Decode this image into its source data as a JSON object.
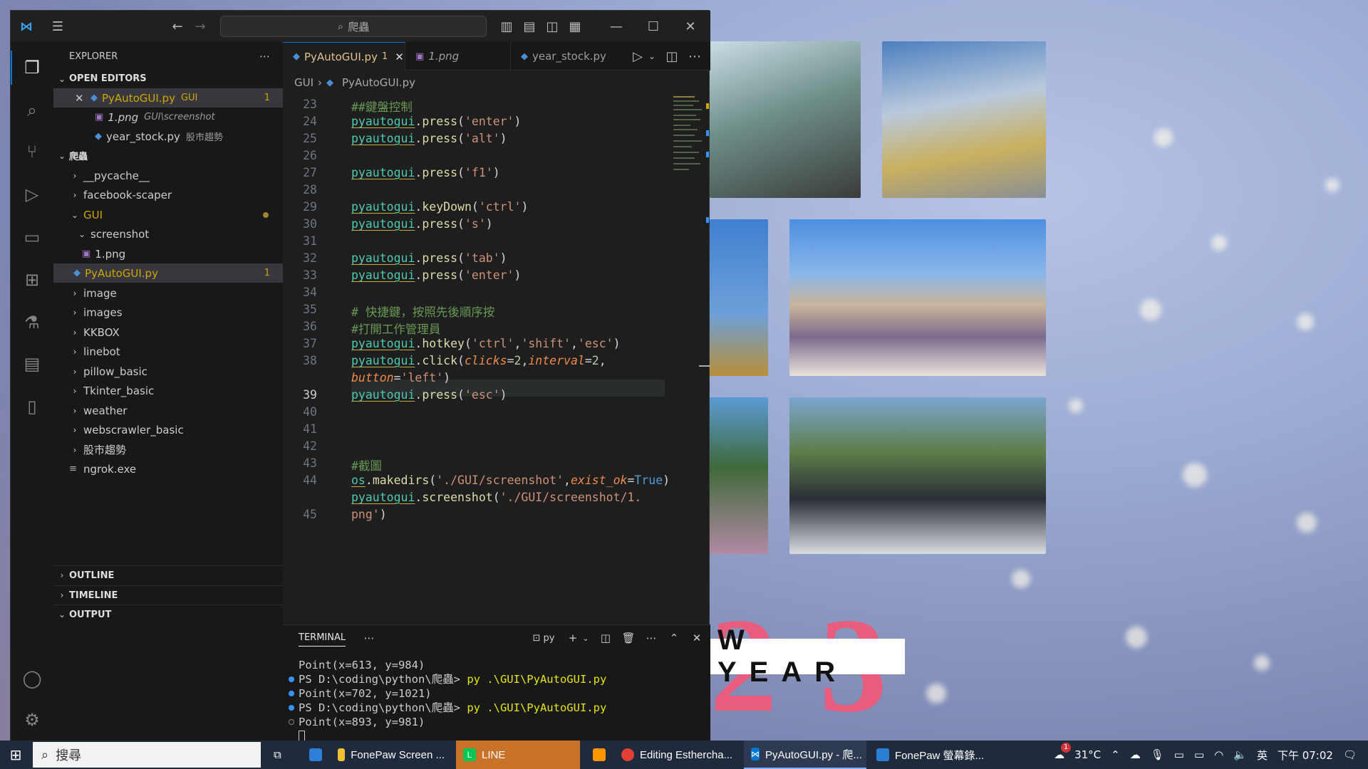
{
  "desktop": {
    "banner_text": "W YEAR",
    "big_digit_left": "2",
    "big_digit_right": "3"
  },
  "titlebar": {
    "search_text": "爬蟲"
  },
  "sidebar": {
    "explorer_title": "EXPLORER",
    "open_editors_title": "OPEN EDITORS",
    "open_editors": [
      {
        "name": "PyAutoGUI.py",
        "desc": "GUI",
        "badge": "1"
      },
      {
        "name": "1.png",
        "desc": "GUI\\screenshot"
      },
      {
        "name": "year_stock.py",
        "desc": "股市趨勢"
      }
    ],
    "folder_title": "爬蟲",
    "tree": [
      {
        "name": "__pycache__"
      },
      {
        "name": "facebook-scaper"
      },
      {
        "name": "GUI"
      },
      {
        "name": "screenshot"
      },
      {
        "name": "1.png"
      },
      {
        "name": "PyAutoGUI.py",
        "badge": "1"
      },
      {
        "name": "image"
      },
      {
        "name": "images"
      },
      {
        "name": "KKBOX"
      },
      {
        "name": "linebot"
      },
      {
        "name": "pillow_basic"
      },
      {
        "name": "Tkinter_basic"
      },
      {
        "name": "weather"
      },
      {
        "name": "webscrawler_basic"
      },
      {
        "name": "股市趨勢"
      },
      {
        "name": "ngrok.exe"
      }
    ],
    "outline": "OUTLINE",
    "timeline": "TIMELINE",
    "output": "OUTPUT"
  },
  "tabs": [
    {
      "label": "PyAutoGUI.py",
      "badge": "1"
    },
    {
      "label": "1.png"
    },
    {
      "label": "year_stock.py"
    }
  ],
  "breadcrumb": {
    "folder": "GUI",
    "file": "PyAutoGUI.py"
  },
  "code": {
    "line_numbers": [
      "23",
      "24",
      "25",
      "26",
      "27",
      "28",
      "29",
      "30",
      "31",
      "32",
      "33",
      "34",
      "35",
      "36",
      "37",
      "38",
      "",
      "39",
      "40",
      "41",
      "42",
      "43",
      "44",
      "",
      "45"
    ],
    "current_line": "39"
  },
  "terminal": {
    "title": "TERMINAL",
    "shell_label": "py",
    "lines": [
      "Point(x=613, y=984)",
      "PS D:\\coding\\python\\爬蟲> ",
      "Point(x=702, y=1021)",
      "PS D:\\coding\\python\\爬蟲> ",
      "Point(x=893, y=981)"
    ],
    "command": "py .\\GUI\\PyAutoGUI.py"
  },
  "taskbar": {
    "search_placeholder": "搜尋",
    "items": [
      {
        "label": "FonePaw Screen ..."
      },
      {
        "label": "LINE"
      },
      {
        "label": "Editing Esthercha..."
      },
      {
        "label": "PyAutoGUI.py - 爬..."
      },
      {
        "label": "FonePaw 螢幕錄..."
      }
    ],
    "temperature": "31°C",
    "ime": "英",
    "clock": "下午 07:02",
    "weather_badge": "1"
  }
}
